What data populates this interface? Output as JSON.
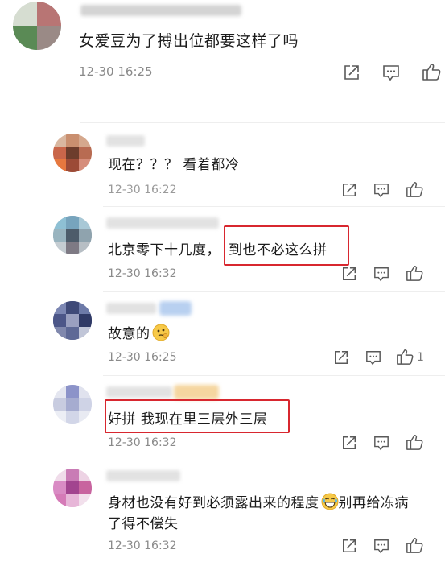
{
  "top_comment": {
    "text": "女爱豆为了搏出位都要这样了吗",
    "time": "12-30 16:25"
  },
  "replies": [
    {
      "text": "现在？？？ 看着都冷",
      "time": "12-30 16:22"
    },
    {
      "text_before": "北京零下十几度，",
      "text_highlight": "到也不必这么拼",
      "time": "12-30 16:32"
    },
    {
      "text": "故意的",
      "time": "12-30 16:25",
      "likes": "1"
    },
    {
      "text": "好拼 我现在里三层外三层",
      "time": "12-30 16:32"
    },
    {
      "text_line1": "身材也没有好到必须露出来的程度",
      "text_line1_after": "别再给冻病",
      "text_line2": "了得不偿失",
      "time": "12-30 16:32"
    }
  ],
  "colors": {
    "highlight_border": "#d8272f",
    "time_text": "#8a8a8a",
    "icon_stroke": "#5a5a5a"
  },
  "icons": [
    "share-icon",
    "comment-icon",
    "like-icon",
    "thinking-emoji-icon",
    "laughing-emoji-icon"
  ]
}
